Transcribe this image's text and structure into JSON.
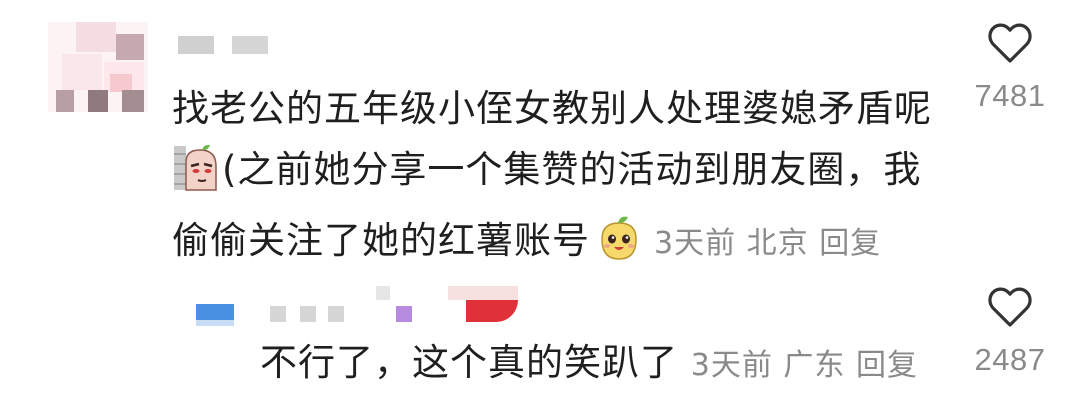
{
  "comment": {
    "username": "",
    "text_line1": "找老公的五年级小侄女教别人处理婆媳矛盾呢",
    "text_line2": "(之前她分享一个集赞的活动到朋友圈，我",
    "text_line3": "偷偷关注了她的红薯账号",
    "time": "3天前",
    "location": "北京",
    "reply_label": "回复",
    "like_count": "7481"
  },
  "reply": {
    "username": "",
    "text": "不行了，这个真的笑趴了",
    "time": "3天前",
    "location": "广东",
    "reply_label": "回复",
    "like_count": "2487"
  },
  "icons": {
    "like": "heart-outline-icon",
    "emoji1": "peeking-potato-emoji",
    "emoji2": "smiling-potato-emoji"
  },
  "colors": {
    "text": "#1f1f1f",
    "meta": "#8a8a8a",
    "heart_stroke": "#333333"
  }
}
